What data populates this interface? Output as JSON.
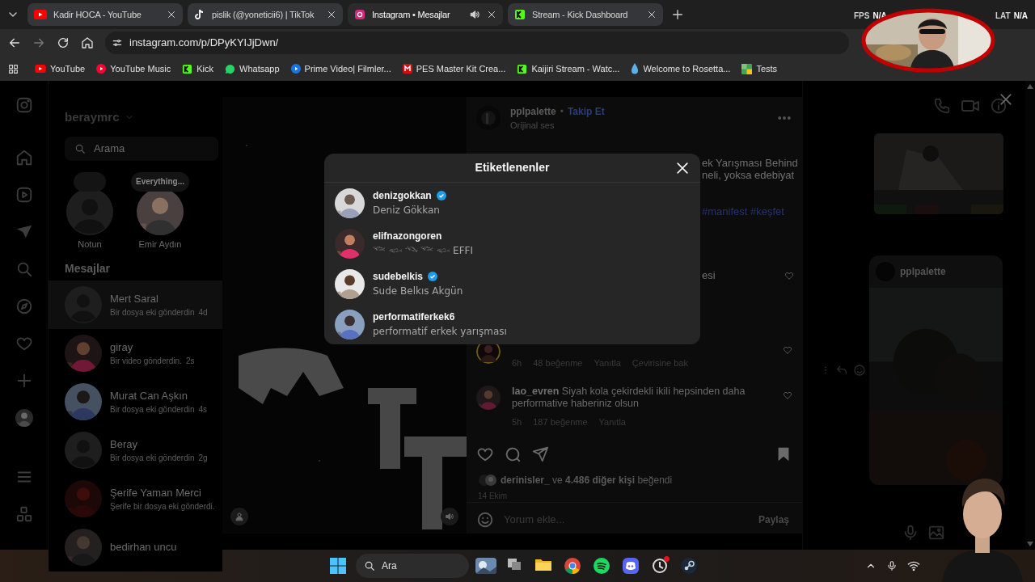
{
  "browser": {
    "tabs": [
      {
        "title": "Kadir HOCA - YouTube",
        "selected": false,
        "audio": false
      },
      {
        "title": "pislik (@yoneticii6) | TikTok",
        "selected": false,
        "audio": false
      },
      {
        "title": "Instagram • Mesajlar",
        "selected": true,
        "audio": true
      },
      {
        "title": "Stream - Kick Dashboard",
        "selected": false,
        "audio": false
      }
    ],
    "url": "instagram.com/p/DPyKYIJjDwn/",
    "bookmarks": [
      "YouTube",
      "YouTube Music",
      "Kick",
      "Whatsapp",
      "Prime Video| Filmler...",
      "PES Master Kit Crea...",
      "Kaijiri Stream - Watc...",
      "Welcome to Rosetta...",
      "Tests"
    ]
  },
  "stream_overlay": {
    "fps_label": "FPS",
    "fps_value": "N/A",
    "lat_label": "LAT",
    "lat_value": "N/A"
  },
  "sidebar": {
    "username": "beraymrc",
    "search": {
      "placeholder": "Arama"
    },
    "notes": [
      {
        "name": "Notun",
        "has_photo": false
      },
      {
        "name": "Emir Aydın",
        "text": "Everything...",
        "has_photo": true
      }
    ],
    "messages_heading": "Mesajlar",
    "conversations": [
      {
        "name": "Mert Saral",
        "preview": "Bir dosya eki gönderdin",
        "time": "4d",
        "has_photo": false,
        "selected": true
      },
      {
        "name": "giray",
        "preview": "Bir video gönderdin.",
        "time": "2s",
        "has_photo": true,
        "selected": false
      },
      {
        "name": "Murat Can Aşkın",
        "preview": "Bir dosya eki gönderdin",
        "time": "4s",
        "has_photo": true,
        "selected": false
      },
      {
        "name": "Beray",
        "preview": "Bir dosya eki gönderdin",
        "time": "2g",
        "has_photo": false,
        "selected": false
      },
      {
        "name": "Şerife Yaman Merci",
        "preview": "Şerife bir dosya eki gönderdi.",
        "has_photo": true,
        "selected": false
      },
      {
        "name": "bedirhan uncu",
        "has_photo": true,
        "selected": false
      }
    ]
  },
  "post": {
    "author": "pplpalette",
    "separator": "•",
    "follow": "Takip Et",
    "audio": "Orijinal ses",
    "caption_lines": [
      "ek Yarışması Behind",
      "neli, yoksa edebiyat"
    ],
    "hashtags": "#manifest #keşfet",
    "caption_tail": "esi",
    "comments": [
      {
        "time": "6h",
        "likes": "48 beğenme",
        "reply": "Yanıtla",
        "translate": "Çevirisine bak"
      },
      {
        "author": "lao_evren",
        "text": "Siyah kola çekirdekli ikili hepsinden daha performative haberiniz olsun",
        "time": "5h",
        "likes": "187 beğenme",
        "reply": "Yanıtla"
      }
    ],
    "liked_by": "**derinisler_** ve **4.486 diğer kişi** beğendi",
    "date": "14 Ekim",
    "comment_placeholder": "Yorum ekle...",
    "share": "Paylaş"
  },
  "tagged_dialog": {
    "title": "Etiketlenenler",
    "people": [
      {
        "username": "denizgokkan",
        "full_name": "Deniz Gökkan",
        "verified": true
      },
      {
        "username": "elifnazongoren",
        "full_name": "𓆝 𓆟 𓆞 𓆝 𓆟 EFFI",
        "verified": false
      },
      {
        "username": "sudebelkis",
        "full_name": "Sude Belkıs Akgün",
        "verified": true
      },
      {
        "username": "performatiferkek6",
        "full_name": "performatif erkek yarışması",
        "verified": false
      }
    ]
  },
  "chat": {
    "share_author": "pplpalette"
  },
  "taskbar": {
    "search_label": "Ara"
  }
}
